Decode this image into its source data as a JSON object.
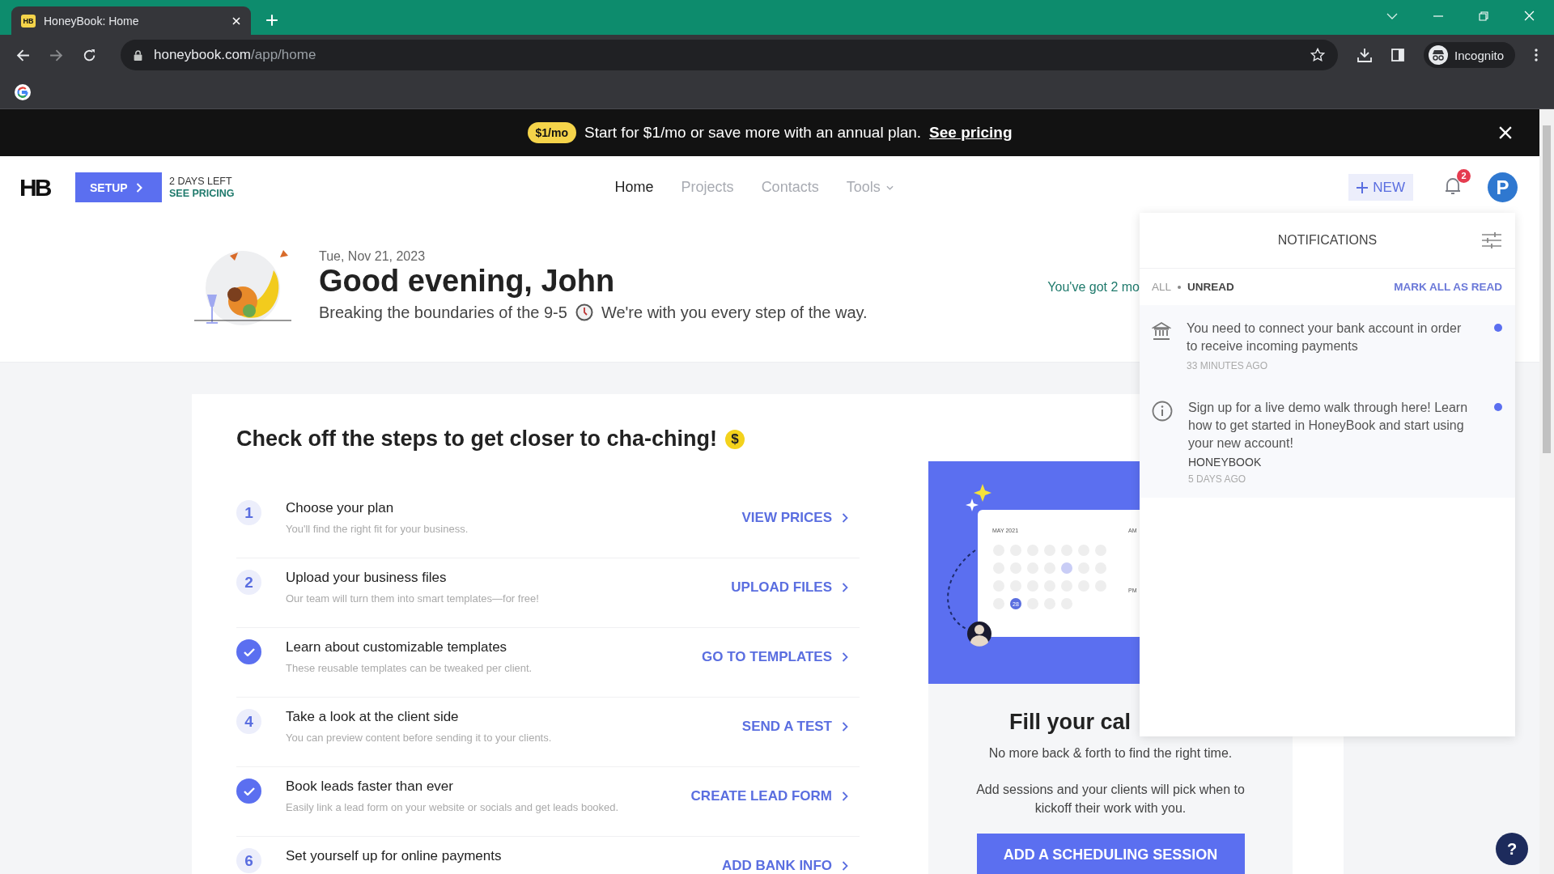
{
  "browser": {
    "tab_title": "HoneyBook: Home",
    "favicon": "HB",
    "url_host": "honeybook.com",
    "url_path": "/app/home",
    "profile": "Incognito"
  },
  "banner": {
    "badge": "$1/mo",
    "message": "Start for $1/mo or save more with an annual plan.",
    "link": "See pricing"
  },
  "header": {
    "logo": "HB",
    "setup_button": "SETUP",
    "trial_days": "2 DAYS LEFT",
    "trial_link": "SEE PRICING",
    "nav": [
      {
        "label": "Home",
        "selected": true,
        "dropdown": false
      },
      {
        "label": "Projects",
        "selected": false,
        "dropdown": false
      },
      {
        "label": "Contacts",
        "selected": false,
        "dropdown": false
      },
      {
        "label": "Tools",
        "selected": false,
        "dropdown": true
      }
    ],
    "new_button": "NEW",
    "notification_count": "2",
    "avatar": "P"
  },
  "greeting": {
    "date": "Tue, Nov 21, 2023",
    "title": "Good evening, John",
    "subtitle_before": "Breaking the boundaries of the 9-5",
    "subtitle_after": "We're with you every step of the way.",
    "side_note": "You've got 2 mo"
  },
  "steps": {
    "title": "Check off the steps to get closer to cha-ching!",
    "coin": "$",
    "items": [
      {
        "number": "1",
        "done": false,
        "title": "Choose your plan",
        "description": "You'll find the right fit for your business.",
        "action": "VIEW PRICES"
      },
      {
        "number": "2",
        "done": false,
        "title": "Upload your business files",
        "description": "Our team will turn them into smart templates—for free!",
        "action": "UPLOAD FILES"
      },
      {
        "done": true,
        "title": "Learn about customizable templates",
        "description": "These reusable templates can be tweaked per client.",
        "action": "GO TO TEMPLATES"
      },
      {
        "number": "4",
        "done": false,
        "title": "Take a look at the client side",
        "description": "You can preview content before sending it to your clients.",
        "action": "SEND A TEST"
      },
      {
        "done": true,
        "title": "Book leads faster than ever",
        "description": "Easily link a lead form on your website or socials and get leads booked.",
        "action": "CREATE LEAD FORM"
      },
      {
        "number": "6",
        "done": false,
        "title": "Set yourself up for online payments",
        "action": "ADD BANK INFO"
      }
    ]
  },
  "promo": {
    "illustration": {
      "month": "MAY 2021",
      "am": "AM",
      "pm": "PM",
      "selected_day": "28"
    },
    "title": "Fill your cal",
    "line_1": "No more back & forth to find the right time.",
    "line_2": "Add sessions and your clients will pick when to kickoff their work with you.",
    "button": "ADD A SCHEDULING SESSION"
  },
  "notifications": {
    "title": "NOTIFICATIONS",
    "filters": [
      {
        "label": "ALL",
        "selected": false
      },
      {
        "label": "UNREAD",
        "selected": true
      }
    ],
    "mark_all": "MARK ALL AS READ",
    "items": [
      {
        "kind": "bank",
        "text": "You need to connect your bank account in order to receive incoming payments",
        "time": "33 MINUTES AGO",
        "unread": true
      },
      {
        "kind": "info",
        "text": "Sign up for a live demo walk through here! Learn how to get started in HoneyBook and start using your new account!",
        "sender": "HONEYBOOK",
        "time": "5 DAYS AGO",
        "unread": true
      }
    ]
  },
  "help": "?"
}
